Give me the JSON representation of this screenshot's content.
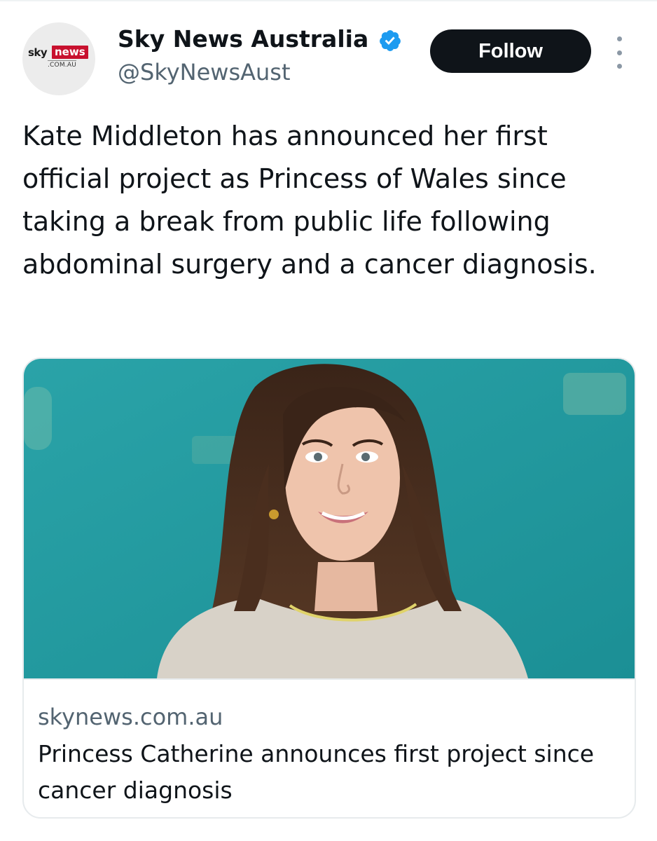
{
  "header": {
    "display_name": "Sky News Australia",
    "handle": "@SkyNewsAust",
    "verified": true,
    "avatar_logo": {
      "sky": "sky",
      "news": "news",
      "domain": ".COM.AU"
    },
    "follow_label": "Follow",
    "icons": {
      "verified": "verified-badge-icon",
      "more": "more-options-icon"
    }
  },
  "tweet": {
    "text": "Kate Middleton has announced her first official project as Princess of Wales since taking a break from public life following abdominal surgery and a cancer diagnosis."
  },
  "card": {
    "domain": "skynews.com.au",
    "title": "Princess Catherine announces first project since cancer diagnosis"
  },
  "colors": {
    "follow_bg": "#0f1419",
    "verified": "#1d9bf0",
    "secondary_text": "#536471",
    "brand_red": "#c8102e",
    "image_backdrop": "#1f9aa0"
  }
}
